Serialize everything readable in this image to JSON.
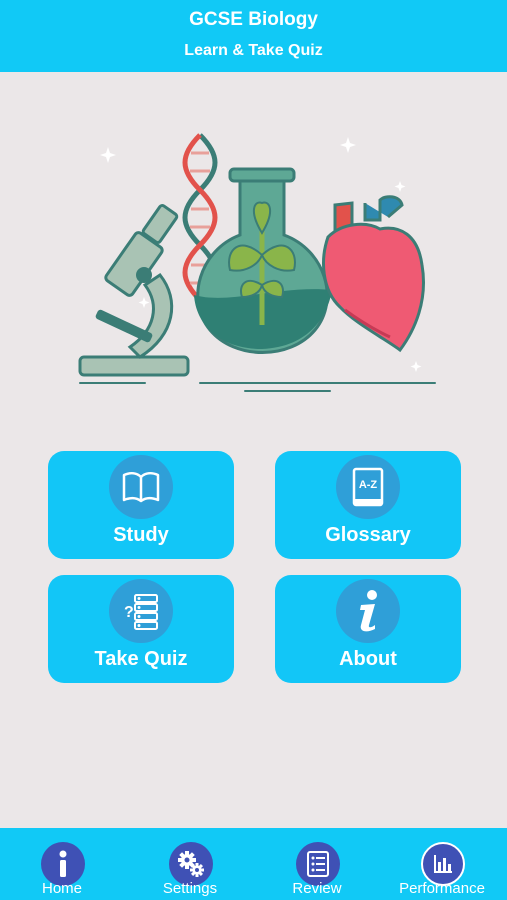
{
  "header": {
    "title": "GCSE Biology",
    "subtitle": "Learn & Take Quiz"
  },
  "menu": {
    "study": "Study",
    "glossary": "Glossary",
    "take_quiz": "Take Quiz",
    "about": "About",
    "glossary_icon_text": "A-Z"
  },
  "tabbar": {
    "home": "Home",
    "settings": "Settings",
    "review": "Review",
    "performance": "Performance"
  },
  "colors": {
    "header": "#11c9f6",
    "tile": "#12c6f7",
    "icon_circle": "#2f9fd8",
    "tab_circle": "#3f51b5",
    "background": "#ebe7e8"
  }
}
